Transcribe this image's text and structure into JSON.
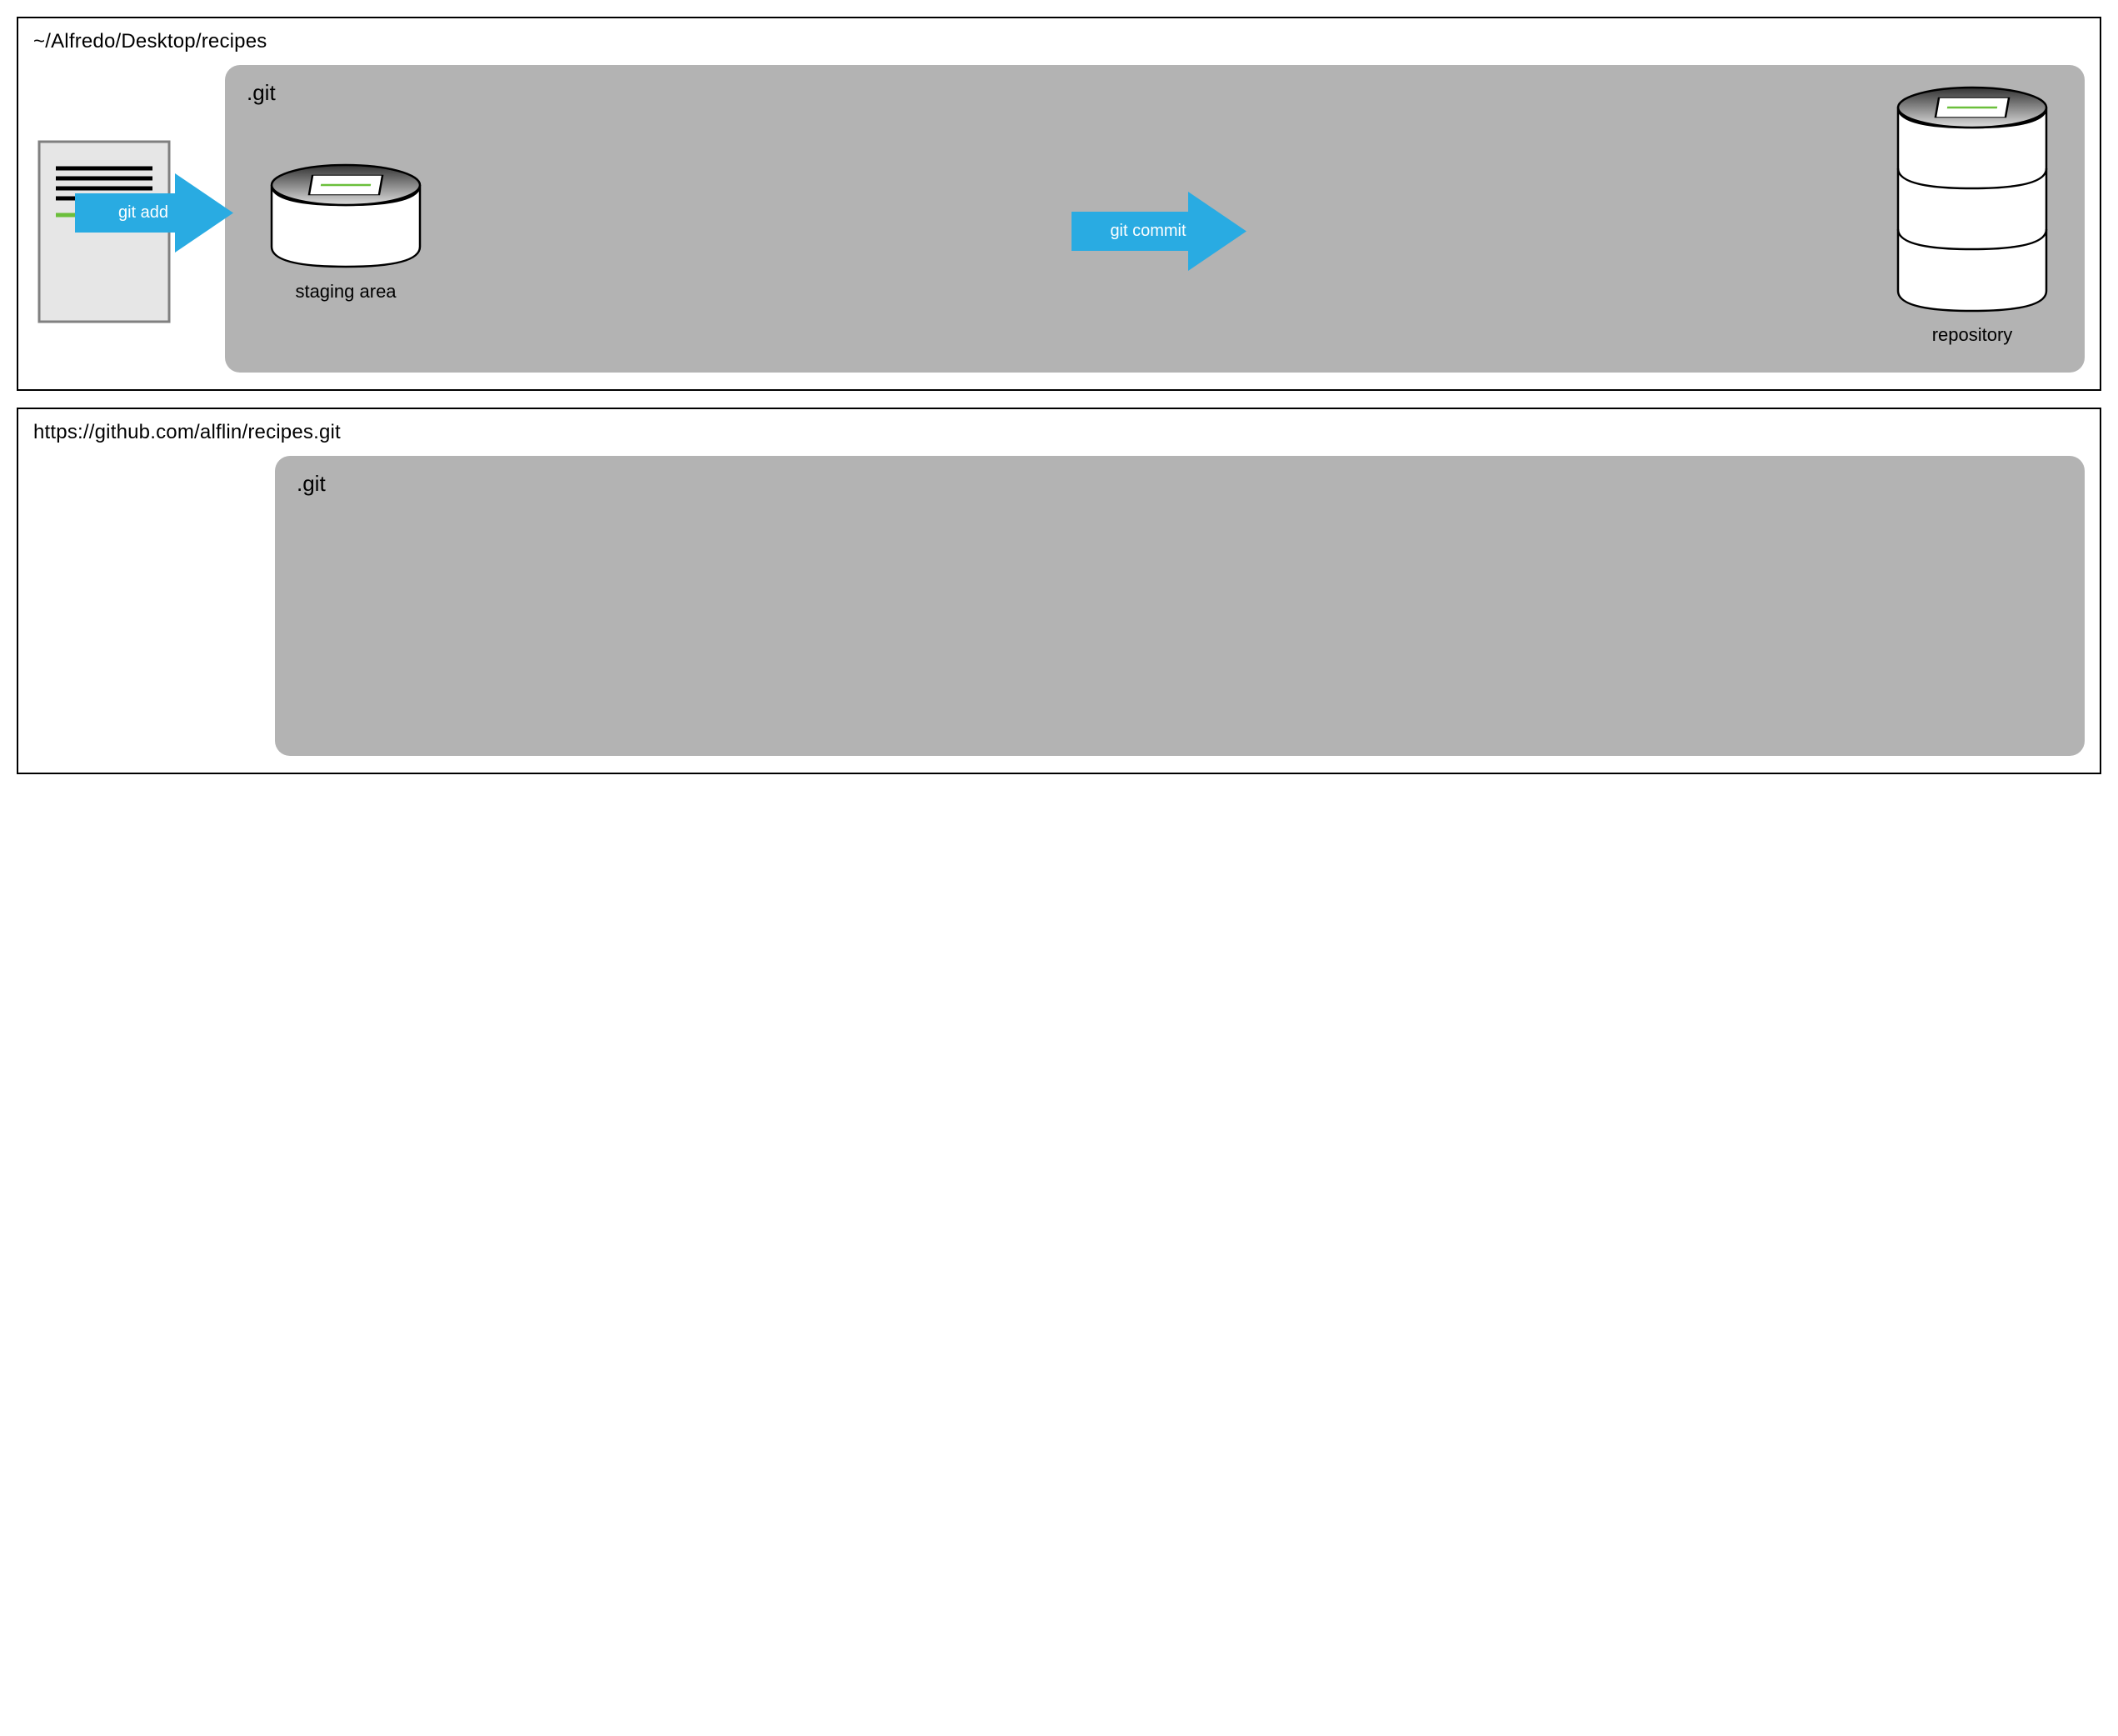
{
  "top": {
    "path_title": "~/Alfredo/Desktop/recipes",
    "git_label": ".git",
    "arrow_add_label": "git add",
    "arrow_commit_label": "git commit",
    "staging_caption": "staging area",
    "repository_caption": "repository"
  },
  "bottom": {
    "url_title": "https://github.com/alflin/recipes.git",
    "git_label": ".git"
  },
  "colors": {
    "arrow": "#29abe2",
    "grey_area": "#b3b3b3",
    "file_fill": "#e6e6e6",
    "file_stroke": "#808080",
    "highlight_line": "#6bbf3b"
  }
}
